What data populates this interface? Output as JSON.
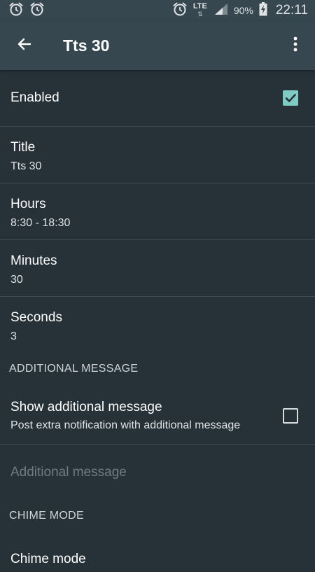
{
  "status_bar": {
    "battery_percent": "90%",
    "network": "LTE",
    "time": "22:11"
  },
  "app_bar": {
    "title": "Tts 30"
  },
  "settings": {
    "enabled": {
      "label": "Enabled",
      "checked": true
    },
    "title": {
      "label": "Title",
      "value": "Tts 30"
    },
    "hours": {
      "label": "Hours",
      "value": "8:30 - 18:30"
    },
    "minutes": {
      "label": "Minutes",
      "value": "30"
    },
    "seconds": {
      "label": "Seconds",
      "value": "3"
    }
  },
  "additional_message_section": {
    "header": "ADDITIONAL MESSAGE",
    "show": {
      "label": "Show additional message",
      "summary": "Post extra notification with additional message",
      "checked": false
    },
    "message": {
      "label": "Additional message"
    }
  },
  "chime_mode_section": {
    "header": "CHIME MODE",
    "chime_mode": {
      "label": "Chime mode"
    }
  },
  "colors": {
    "background": "#263238",
    "app_bar": "#37474f",
    "accent": "#80cbc4"
  }
}
